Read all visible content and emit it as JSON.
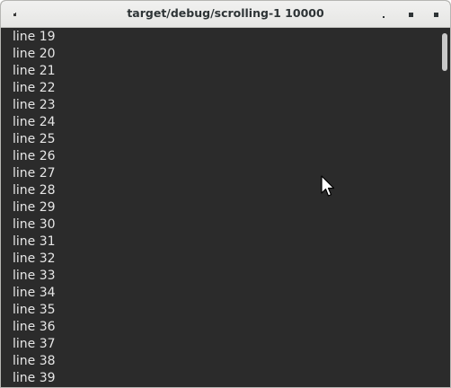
{
  "window": {
    "title": "target/debug/scrolling-1 10000"
  },
  "icons": {
    "app_menu": "app-menu-icon",
    "minimize": "minimize-icon",
    "maximize": "maximize-icon",
    "close": "close-icon",
    "cursor": "mouse-pointer-icon"
  },
  "colors": {
    "content_background": "#2b2b2b",
    "text": "#e6e6e6",
    "titlebar": "#ececea",
    "scroll_thumb": "#c9c9c9"
  },
  "lines": [
    "line 19",
    "line 20",
    "line 21",
    "line 22",
    "line 23",
    "line 24",
    "line 25",
    "line 26",
    "line 27",
    "line 28",
    "line 29",
    "line 30",
    "line 31",
    "line 32",
    "line 33",
    "line 34",
    "line 35",
    "line 36",
    "line 37",
    "line 38",
    "line 39"
  ],
  "scrollbar": {
    "position_fraction": 0.002
  }
}
